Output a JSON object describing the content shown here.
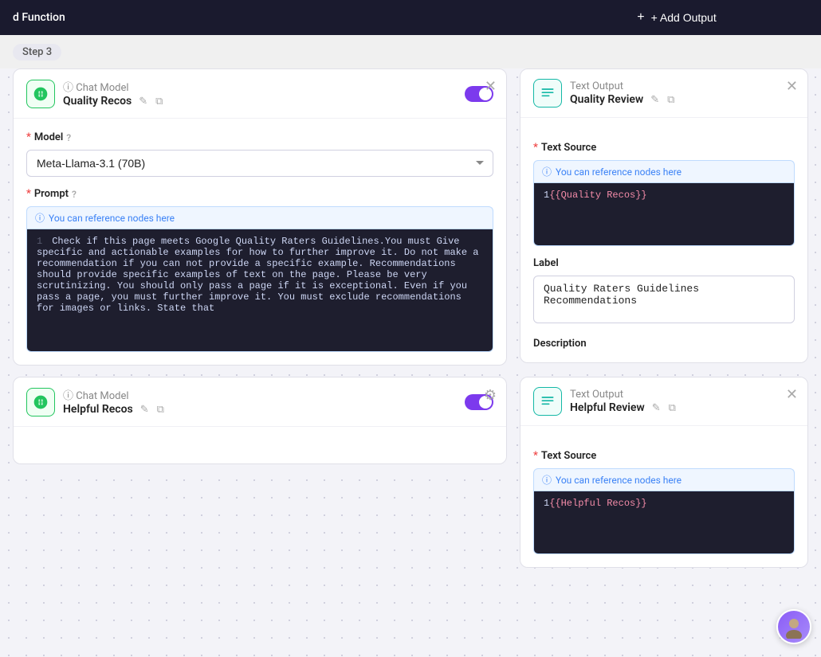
{
  "header": {
    "left_title": "d Function",
    "add_output_label": "+ Add Output"
  },
  "step": {
    "label": "Step 3"
  },
  "card1": {
    "type_prefix": "ⓘ",
    "type_label": "Chat Model",
    "name": "Quality Recos",
    "toggle_on": true,
    "model_label": "Model",
    "model_help": "?",
    "model_value": "Meta-Llama-3.1 (70B)",
    "prompt_label": "Prompt",
    "prompt_help": "?",
    "reference_hint": "ⓘ You can reference nodes here",
    "prompt_text": "Check if this page meets Google Quality Raters Guidelines.You must Give specific and actionable examples for how to further improve it. Do not make a recommendation if you can not provide a specific example. Recommendations should provide specific examples of text on the page. Please be very scrutinizing. You should only pass a page if it is exceptional. Even if you pass a page, you must further improve it. You must exclude recommendations for images or links. State that"
  },
  "card2": {
    "type_prefix": "ⓘ",
    "type_label": "Chat Model",
    "name": "Helpful Recos",
    "toggle_on": true
  },
  "output_card1": {
    "type_label": "Text Output",
    "name": "Quality Review",
    "text_source_label": "Text Source",
    "reference_hint": "ⓘ You can reference nodes here",
    "template_var": "{{Quality Recos}}",
    "label_section_label": "Label",
    "label_value": "Quality Raters Guidelines\nRecommendations",
    "description_label": "Description"
  },
  "output_card2": {
    "type_label": "Text Output",
    "name": "Helpful Review",
    "text_source_label": "Text Source",
    "reference_hint": "ⓘ You can reference nodes here",
    "template_var": "{{Helpful Recos}}"
  },
  "icons": {
    "openai": "✦",
    "text_output": "≡",
    "close": "✕",
    "edit": "✎",
    "copy": "⧉",
    "gear": "⚙",
    "info": "ⓘ",
    "plus": "+"
  },
  "line_numbers": {
    "prompt_line": "1",
    "source_line": "1"
  }
}
